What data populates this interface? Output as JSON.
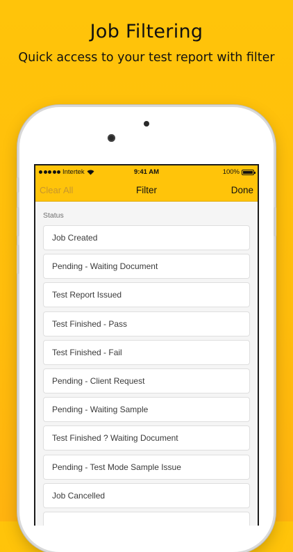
{
  "promo": {
    "title": "Job Filtering",
    "subtitle": "Quick access to your test report with filter"
  },
  "status_bar": {
    "carrier": "Intertek",
    "time": "9:41 AM",
    "battery": "100%"
  },
  "nav": {
    "left_label": "Clear All",
    "title": "Filter",
    "right_label": "Done"
  },
  "section": {
    "label": "Status"
  },
  "status_options": [
    "Job Created",
    "Pending - Waiting Document",
    "Test Report Issued",
    "Test Finished - Pass",
    "Test Finished - Fail",
    "Pending - Client Request",
    "Pending - Waiting Sample",
    "Test Finished ? Waiting Document",
    "Pending - Test Mode Sample Issue",
    "Job Cancelled",
    ""
  ],
  "colors": {
    "background": "#ffc40a",
    "nav_bar": "#ffc40a",
    "disabled_text": "#c7962d"
  }
}
